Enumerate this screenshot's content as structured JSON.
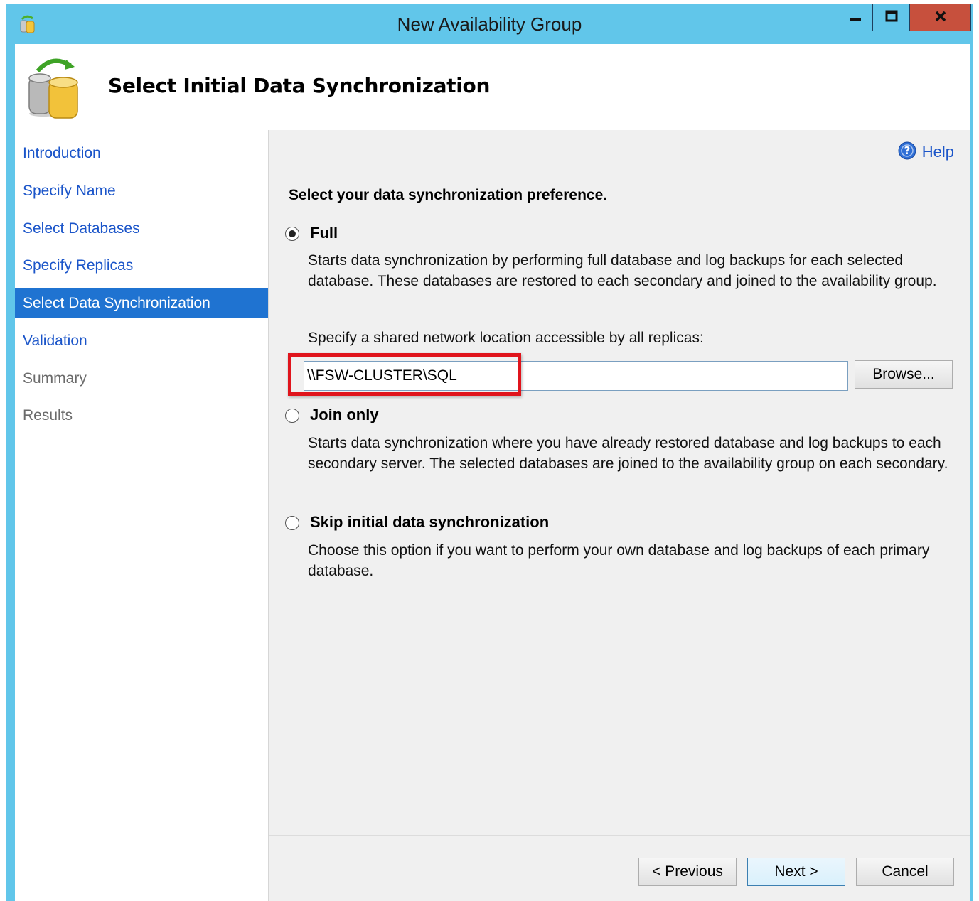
{
  "window": {
    "title": "New Availability Group",
    "controls": {
      "minimize": "minimize",
      "maximize": "maximize",
      "close": "close"
    }
  },
  "header": {
    "title": "Select Initial Data Synchronization",
    "icon": "database-sync-icon"
  },
  "sidebar": {
    "items": [
      {
        "label": "Introduction",
        "state": "link"
      },
      {
        "label": "Specify Name",
        "state": "link"
      },
      {
        "label": "Select Databases",
        "state": "link"
      },
      {
        "label": "Specify Replicas",
        "state": "link"
      },
      {
        "label": "Select Data Synchronization",
        "state": "active"
      },
      {
        "label": "Validation",
        "state": "link"
      },
      {
        "label": "Summary",
        "state": "disabled"
      },
      {
        "label": "Results",
        "state": "disabled"
      }
    ]
  },
  "main": {
    "help_label": "Help",
    "prompt": "Select your data synchronization preference.",
    "options": {
      "full": {
        "label": "Full",
        "selected": true,
        "description": "Starts data synchronization by performing full database and log backups for each selected database. These databases are restored to each secondary and joined to the availability group."
      },
      "join": {
        "label": "Join only",
        "selected": false,
        "description": "Starts data synchronization where you have already restored database and log backups to each secondary server. The selected databases are joined to the availability group on each secondary."
      },
      "skip": {
        "label": "Skip initial data synchronization",
        "selected": false,
        "description": "Choose this option if you want to perform your own database and log backups of each primary database."
      }
    },
    "path_label": "Specify a shared network location accessible by all replicas:",
    "path_value": "\\\\FSW-CLUSTER\\SQL",
    "browse_label": "Browse..."
  },
  "footer": {
    "previous_label": "< Previous",
    "next_label": "Next >",
    "cancel_label": "Cancel"
  },
  "colors": {
    "titlebar": "#61c6ea",
    "close_button": "#c7503d",
    "link": "#1b55c9",
    "active_nav": "#1f73d1",
    "highlight_box": "#e0141c"
  }
}
